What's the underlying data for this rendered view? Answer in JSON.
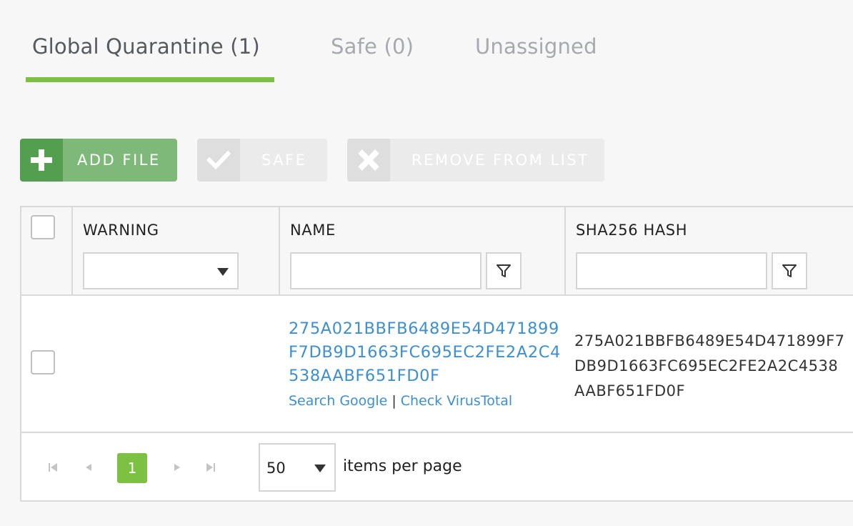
{
  "tabs": [
    {
      "label": "Global Quarantine (1)",
      "active": true
    },
    {
      "label": "Safe (0)",
      "active": false
    },
    {
      "label": "Unassigned",
      "active": false
    }
  ],
  "toolbar": {
    "add_label": "ADD FILE",
    "safe_label": "SAFE",
    "remove_label": "REMOVE FROM LIST"
  },
  "colors": {
    "accent": "#7dc142",
    "add_button": "#7fb97a",
    "link": "#3d8fd1"
  },
  "grid": {
    "columns": {
      "warning": "WARNING",
      "name": "NAME",
      "hash": "SHA256 HASH"
    },
    "filters": {
      "warning_value": "",
      "name_value": "",
      "hash_value": ""
    },
    "rows": [
      {
        "warning": "",
        "name": "275A021BBFB6489E54D471899F7DB9D1663FC695EC2FE2A2C4538AABF651FD0F",
        "search_google": "Search Google",
        "separator": "|",
        "check_virustotal": "Check VirusTotal",
        "hash": "275A021BBFB6489E54D471899F7DB9D1663FC695EC2FE2A2C4538AABF651FD0F"
      }
    ]
  },
  "pager": {
    "current_page": "1",
    "page_size": "50",
    "page_size_label": "items per page"
  }
}
